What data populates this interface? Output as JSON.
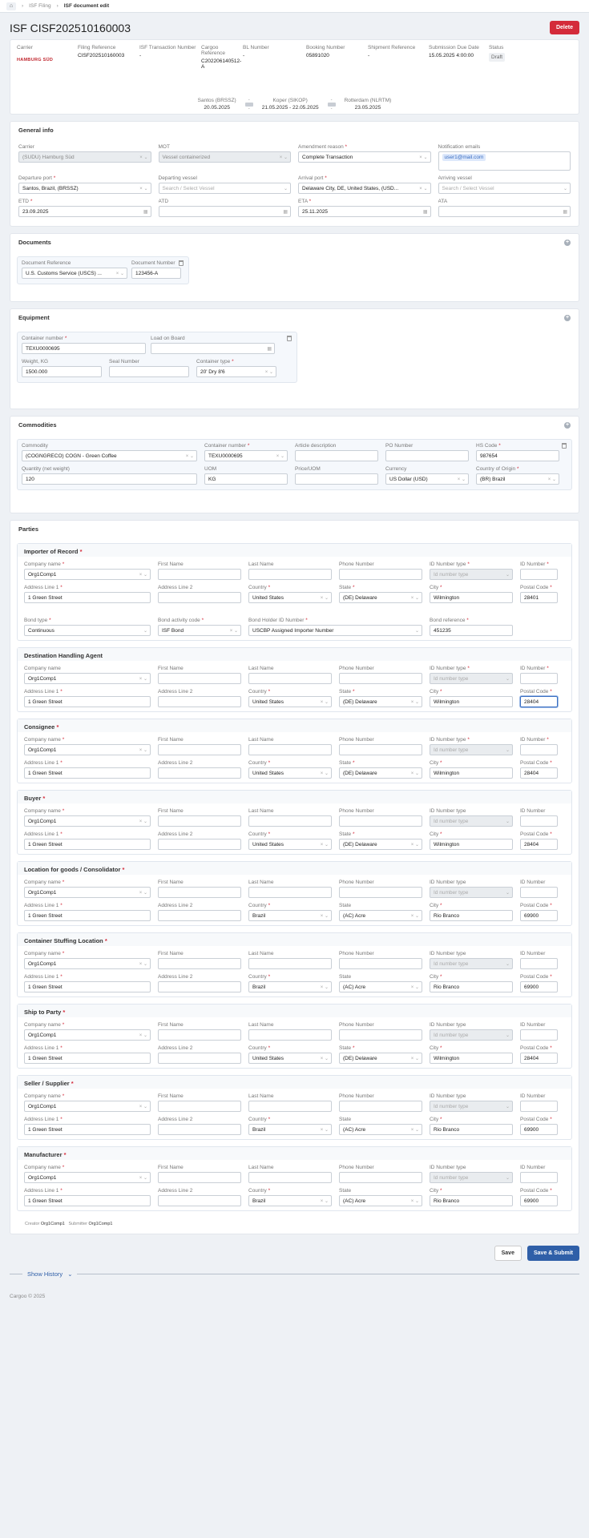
{
  "breadcrumb": {
    "items": [
      "ISF Filing",
      "ISF document edit"
    ]
  },
  "page": {
    "title": "ISF CISF202510160003",
    "delete_label": "Delete"
  },
  "summary": {
    "carrier_label": "Carrier",
    "carrier_logo": "HAMBURG SÜD",
    "filing_label": "Filing Reference",
    "filing_value": "CISF202510160003",
    "isf_tx_label": "ISF Transaction Number",
    "isf_tx_value": "-",
    "cargoo_label": "Cargoo Reference",
    "cargoo_value": "C202206140512-A",
    "bl_label": "BL Number",
    "bl_value": "-",
    "booking_label": "Booking Number",
    "booking_value": "05891020",
    "shipment_label": "Shipment Reference",
    "shipment_value": "-",
    "due_label": "Submission Due Date",
    "due_value": "15.05.2025 4:00:00",
    "status_label": "Status",
    "status_value": "Draft"
  },
  "route": {
    "stops": [
      {
        "name": "Santos (BRSSZ)",
        "date": "20.05.2025"
      },
      {
        "name": "Koper (SIKOP)",
        "date": "21.05.2025 - 22.05.2025"
      },
      {
        "name": "Rotterdam (NLRTM)",
        "date": "23.05.2025"
      }
    ],
    "leg_marks": [
      "-",
      "-",
      "-",
      "-"
    ]
  },
  "general": {
    "title": "General info",
    "carrier_label": "Carrier",
    "carrier_value": "(SUDU) Hamburg Süd",
    "mot_label": "MOT",
    "mot_value": "Vessel containerized",
    "amend_label": "Amendment reason",
    "amend_value": "Complete Transaction",
    "notif_label": "Notification emails",
    "notif_value": "user1@mail.com",
    "dep_port_label": "Departure port",
    "dep_port_value": "Santos, Brazil, (BRSSZ)",
    "dep_vessel_label": "Departing vessel",
    "dep_vessel_ph": "Search / Select Vessel",
    "arr_port_label": "Arrival port",
    "arr_port_value": "Delaware City, DE, United States, (USD...",
    "arr_vessel_label": "Arriving vessel",
    "arr_vessel_ph": "Search / Select Vessel",
    "etd_label": "ETD",
    "etd_value": "23.09.2025",
    "atd_label": "ATD",
    "atd_value": "",
    "eta_label": "ETA",
    "eta_value": "25.11.2025",
    "ata_label": "ATA",
    "ata_value": ""
  },
  "documents": {
    "title": "Documents",
    "ref_label": "Document Reference",
    "ref_value": "U.S. Customs Service (USCS) ...",
    "num_label": "Document Number",
    "num_value": "123456-A"
  },
  "equipment": {
    "title": "Equipment",
    "container_label": "Container number",
    "container_value": "TEXU0000695",
    "load_label": "Load on Board",
    "load_value": "",
    "weight_label": "Weight, KG",
    "weight_value": "1500.000",
    "seal_label": "Seal Number",
    "seal_value": "",
    "type_label": "Container type",
    "type_value": "20' Dry 8'6"
  },
  "commodities": {
    "title": "Commodities",
    "commodity_label": "Commodity",
    "commodity_value": "(COGNGRECO) COGN - Green Coffee",
    "container_label": "Container number",
    "container_value": "TEXU0000695",
    "desc_label": "Article description",
    "desc_value": "",
    "po_label": "PO Number",
    "po_value": "",
    "hs_label": "HS Code",
    "hs_value": "987654",
    "qty_label": "Quantity (net weight)",
    "qty_value": "120",
    "uom_label": "UOM",
    "uom_value": "KG",
    "price_label": "Price/UOM",
    "price_value": "",
    "currency_label": "Currency",
    "currency_value": "US Dollar (USD)",
    "origin_label": "Country of Origin",
    "origin_value": "(BR) Brazil"
  },
  "parties_title": "Parties",
  "labels": {
    "company": "Company name",
    "first": "First Name",
    "last": "Last Name",
    "phone": "Phone Number",
    "idtype": "ID Number type",
    "idnum": "ID Number",
    "idtype_ph": "Id number type",
    "addr1": "Address Line 1",
    "addr2": "Address Line 2",
    "country": "Country",
    "state": "State",
    "city": "City",
    "postal": "Postal Code"
  },
  "bond": {
    "type_label": "Bond type",
    "type_value": "Continuous",
    "activity_label": "Bond activity code",
    "activity_value": "ISF Bond",
    "holder_label": "Bond Holder ID Number",
    "holder_value": "USCBP Assigned Importer Number",
    "ref_label": "Bond reference",
    "ref_value": "451235"
  },
  "parties": [
    {
      "title": "Importer of Record",
      "company": "Org1Comp1",
      "addr1": "1 Green Street",
      "country": "United States",
      "state": "(DE) Delaware",
      "city": "Wilmington",
      "postal": "28401"
    },
    {
      "title": "Destination Handling Agent",
      "company": "Org1Comp1",
      "addr1": "1 Green Street",
      "country": "United States",
      "state": "(DE) Delaware",
      "city": "Wilmington",
      "postal": "28404"
    },
    {
      "title": "Consignee",
      "company": "Org1Comp1",
      "addr1": "1 Green Street",
      "country": "United States",
      "state": "(DE) Delaware",
      "city": "Wilmington",
      "postal": "28404"
    },
    {
      "title": "Buyer",
      "company": "Org1Comp1",
      "addr1": "1 Green Street",
      "country": "United States",
      "state": "(DE) Delaware",
      "city": "Wilmington",
      "postal": "28404"
    },
    {
      "title": "Location for goods / Consolidator",
      "company": "Org1Comp1",
      "addr1": "1 Green Street",
      "country": "Brazil",
      "state": "(AC) Acre",
      "city": "Rio Branco",
      "postal": "69900"
    },
    {
      "title": "Container Stuffing Location",
      "company": "Org1Comp1",
      "addr1": "1 Green Street",
      "country": "Brazil",
      "state": "(AC) Acre",
      "city": "Rio Branco",
      "postal": "69900"
    },
    {
      "title": "Ship to Party",
      "company": "Org1Comp1",
      "addr1": "1 Green Street",
      "country": "United States",
      "state": "(DE) Delaware",
      "city": "Wilmington",
      "postal": "28404"
    },
    {
      "title": "Seller / Supplier",
      "company": "Org1Comp1",
      "addr1": "1 Green Street",
      "country": "Brazil",
      "state": "(AC) Acre",
      "city": "Rio Branco",
      "postal": "69900"
    },
    {
      "title": "Manufacturer",
      "company": "Org1Comp1",
      "addr1": "1 Green Street",
      "country": "Brazil",
      "state": "(AC) Acre",
      "city": "Rio Branco",
      "postal": "69900"
    }
  ],
  "meta": {
    "creator_label": "Creator",
    "creator_value": "Org1Comp1",
    "submitter_label": "Submitter",
    "submitter_value": "Org1Comp1"
  },
  "footer": {
    "save_label": "Save",
    "submit_label": "Save & Submit",
    "history_label": "Show History",
    "copyright": "Cargoo © 2025"
  }
}
